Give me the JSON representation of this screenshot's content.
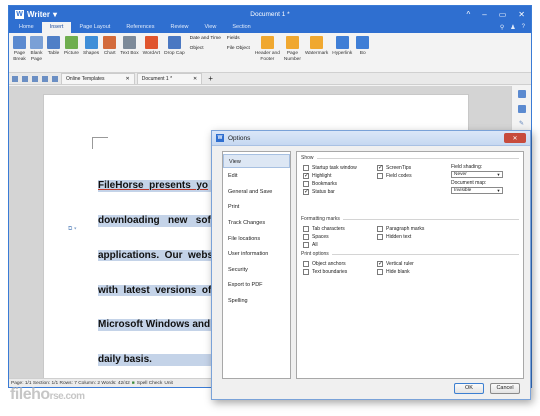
{
  "app": {
    "name": "Writer",
    "doc_title": "Document 1 *",
    "window_controls": [
      "^",
      "–",
      "▭",
      "✕"
    ]
  },
  "menu_tabs": [
    "Home",
    "Insert",
    "Page Layout",
    "References",
    "Review",
    "View",
    "Section"
  ],
  "menu_right": [
    "⚲",
    "♟",
    "?"
  ],
  "ribbon": {
    "buttons": [
      {
        "label": "Page\nBreak",
        "color": "#5b8ad0"
      },
      {
        "label": "Blank\nPage",
        "color": "#7aa0d6"
      },
      {
        "label": "Table",
        "color": "#4f7fc7"
      },
      {
        "label": "Picture",
        "color": "#6fae4f"
      },
      {
        "label": "Shapes",
        "color": "#3f8ed8"
      },
      {
        "label": "Chart",
        "color": "#d36a3a"
      },
      {
        "label": "Text Box",
        "color": "#7d8a99"
      },
      {
        "label": "WordArt",
        "color": "#e0552e"
      },
      {
        "label": "Drop Cap",
        "color": "#4a78c2"
      }
    ],
    "inline_a": [
      "Date and Time",
      "Object"
    ],
    "inline_b": [
      "Fields",
      "File Object"
    ],
    "buttons_right": [
      {
        "label": "Header and\nFooter",
        "color": "#f0a830"
      },
      {
        "label": "Page\nNumber",
        "color": "#f0a830"
      },
      {
        "label": "Watermark",
        "color": "#f0a830"
      },
      {
        "label": "Hyperlink",
        "color": "#3f7ed6"
      },
      {
        "label": "Bo",
        "color": "#3f7ed6"
      }
    ]
  },
  "doc_tabs": [
    {
      "label": "Online Templates",
      "close": "✕"
    },
    {
      "label": "Document 1 *",
      "close": "✕"
    }
  ],
  "doc_tab_add": "+",
  "document": {
    "lines": [
      "FileHorse  presents  yo",
      "downloading   new   sof",
      "applications.  Our  webs",
      "with  latest  versions  of",
      "Microsoft Windows and",
      "daily basis."
    ]
  },
  "status": {
    "text": "Page: 1/1  Section: 1/1  Rows: 7  Column: 2  Words: 42/42",
    "spell": "Spell Check",
    "tail": "Unit"
  },
  "watermark": {
    "text": "fileh",
    "suffix": "rse.com",
    "mid": "o"
  },
  "dialog": {
    "title": "Options",
    "close": "✕",
    "nav": [
      "View",
      "Edit",
      "General and Save",
      "Print",
      "Track Changes",
      "File locations",
      "User information",
      "Security",
      "Export to PDF",
      "Spelling"
    ],
    "selected_nav": "View",
    "show": {
      "title": "Show",
      "col1": [
        {
          "label": "Startup task window",
          "checked": false
        },
        {
          "label": "Highlight",
          "checked": true
        },
        {
          "label": "Bookmarks",
          "checked": false
        },
        {
          "label": "Status bar",
          "checked": true
        }
      ],
      "col2": [
        {
          "label": "ScreenTips",
          "checked": true
        },
        {
          "label": "Field codes",
          "checked": false
        }
      ],
      "field_shading_label": "Field shading:",
      "field_shading_value": "Never",
      "document_map_label": "Document map:",
      "document_map_value": "Invisible"
    },
    "formatting": {
      "title": "Formatting marks",
      "col1": [
        {
          "label": "Tab characters",
          "checked": false
        },
        {
          "label": "Spaces",
          "checked": false
        },
        {
          "label": "All",
          "checked": false
        }
      ],
      "col2": [
        {
          "label": "Paragraph marks",
          "checked": false
        },
        {
          "label": "Hidden text",
          "checked": false
        }
      ]
    },
    "print_options": {
      "title": "Print options",
      "col1": [
        {
          "label": "Object anchors",
          "checked": false
        },
        {
          "label": "Text boundaries",
          "checked": false
        }
      ],
      "col2": [
        {
          "label": "Vertical ruler",
          "checked": true
        },
        {
          "label": "Hide blank",
          "checked": false
        }
      ]
    },
    "ok_label": "OK",
    "cancel_label": "Cancel"
  }
}
